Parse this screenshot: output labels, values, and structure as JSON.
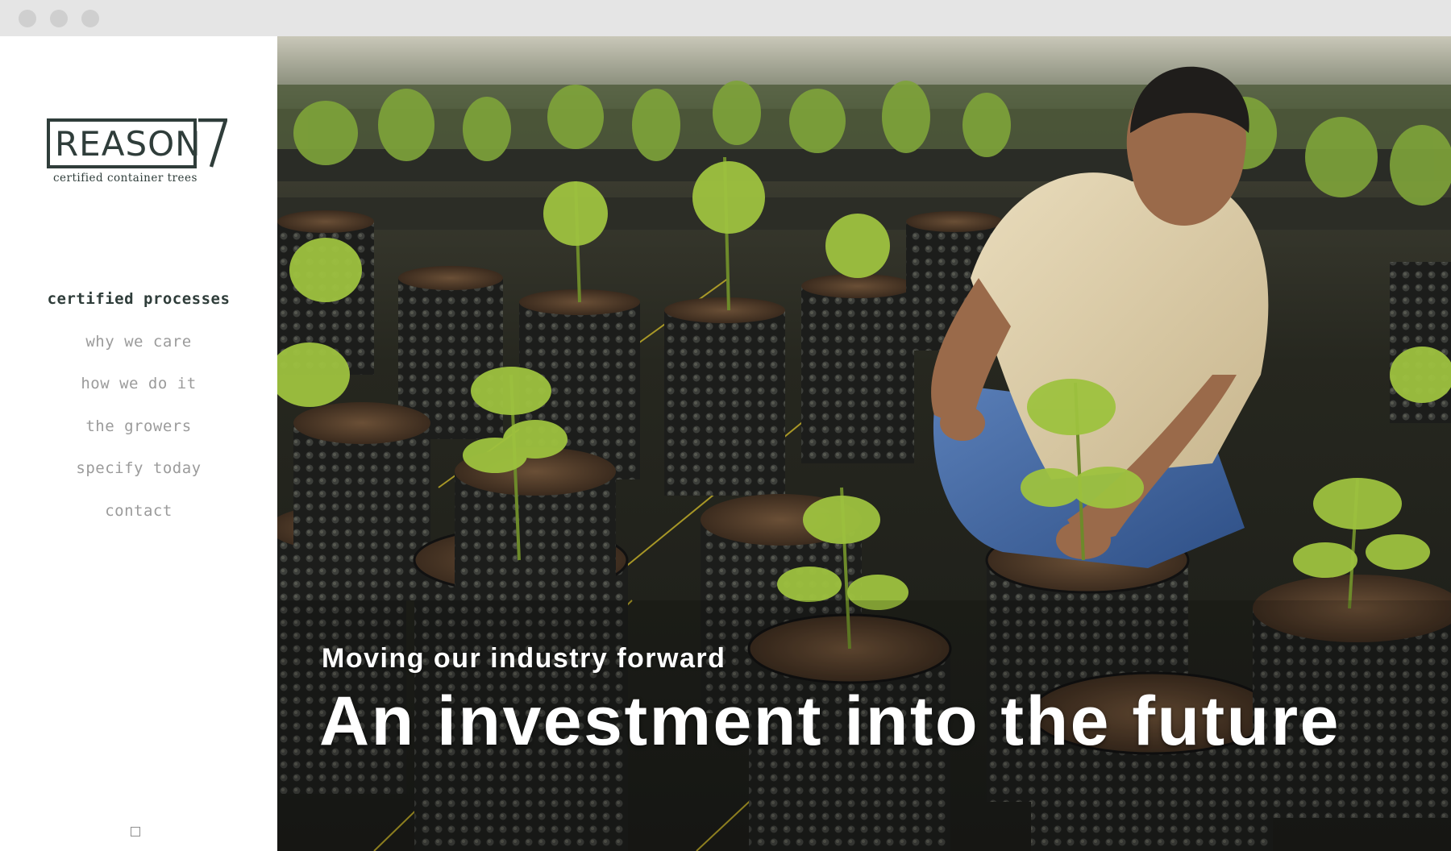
{
  "brand": {
    "name": "REASON",
    "tagline": "certified container trees",
    "color": "#2f3d3a"
  },
  "nav": {
    "items": [
      {
        "label": "certified processes",
        "active": true
      },
      {
        "label": "why we care",
        "active": false
      },
      {
        "label": "how we do it",
        "active": false
      },
      {
        "label": "the growers",
        "active": false
      },
      {
        "label": "specify today",
        "active": false
      },
      {
        "label": "contact",
        "active": false
      }
    ]
  },
  "hero": {
    "subheading": "Moving our industry forward",
    "heading": "An investment into the future",
    "image_subject": "nursery worker tending young trees in black air-pot containers"
  },
  "pager": {
    "icon": "square-outline-icon"
  },
  "colors": {
    "nav_active": "#2f3d3a",
    "nav_inactive": "#9b9b9b",
    "chrome": "#e5e5e5"
  }
}
